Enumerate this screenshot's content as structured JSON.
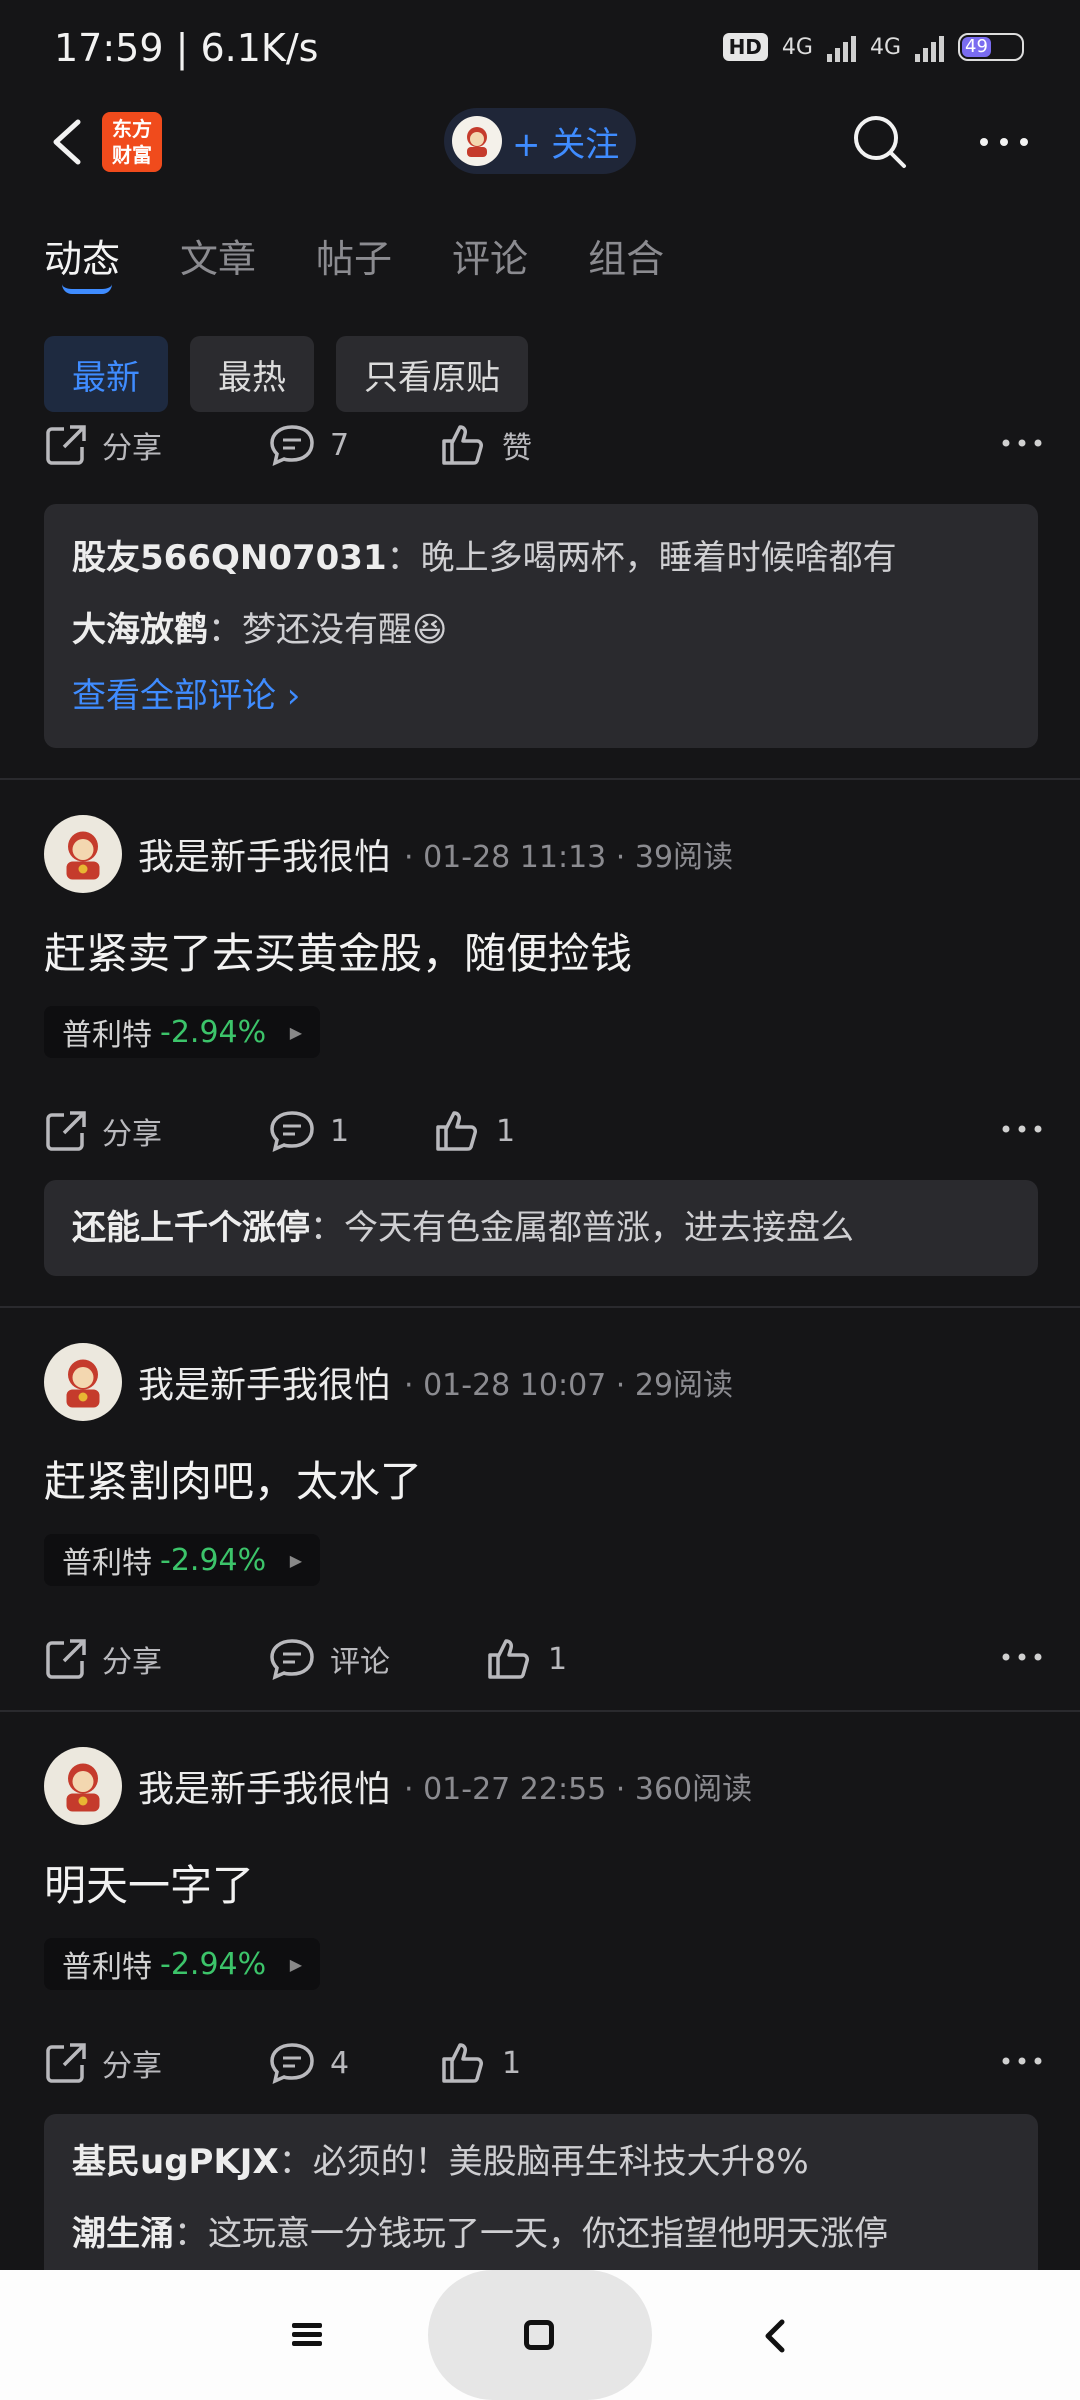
{
  "status": {
    "time": "17:59",
    "speed": "6.1K/s",
    "hd": "HD",
    "net1": "4G",
    "net2": "4G",
    "battery": "49"
  },
  "header": {
    "logo_line1": "东方",
    "logo_line2": "财富",
    "follow_label": "+ 关注"
  },
  "tabs": [
    "动态",
    "文章",
    "帖子",
    "评论",
    "组合"
  ],
  "filters": [
    "最新",
    "最热",
    "只看原贴"
  ],
  "post0": {
    "actions": {
      "share": "分享",
      "comment": "7",
      "like": "赞"
    },
    "comments": [
      {
        "user": "股友566QN07031",
        "text": "晚上多喝两杯，睡着时候啥都有"
      },
      {
        "user": "大海放鹤",
        "text": "梦还没有醒😆"
      }
    ],
    "view_all": "查看全部评论 ›"
  },
  "post1": {
    "user": "我是新手我很怕",
    "time": "01-28 11:13",
    "reads": "39阅读",
    "body": "赶紧卖了去买黄金股，随便捡钱",
    "stock": {
      "name": "普利特",
      "change": "-2.94%"
    },
    "actions": {
      "share": "分享",
      "comment": "1",
      "like": "1"
    },
    "comments": [
      {
        "user": "还能上千个涨停",
        "text": "今天有色金属都普涨，进去接盘么"
      }
    ]
  },
  "post2": {
    "user": "我是新手我很怕",
    "time": "01-28 10:07",
    "reads": "29阅读",
    "body": "赶紧割肉吧，太水了",
    "stock": {
      "name": "普利特",
      "change": "-2.94%"
    },
    "actions": {
      "share": "分享",
      "comment": "评论",
      "like": "1"
    }
  },
  "post3": {
    "user": "我是新手我很怕",
    "time": "01-27 22:55",
    "reads": "360阅读",
    "body": "明天一字了",
    "stock": {
      "name": "普利特",
      "change": "-2.94%"
    },
    "actions": {
      "share": "分享",
      "comment": "4",
      "like": "1"
    },
    "comments": [
      {
        "user": "基民ugPKJX",
        "text": "必须的！美股脑再生科技大升8%"
      },
      {
        "user": "潮生涌",
        "text": "这玩意一分钱玩了一天，你还指望他明天涨停"
      }
    ]
  },
  "colors": {
    "accent": "#3f8cff",
    "down": "#3cc46a",
    "bg": "#151517",
    "card": "#2a2a2e"
  }
}
